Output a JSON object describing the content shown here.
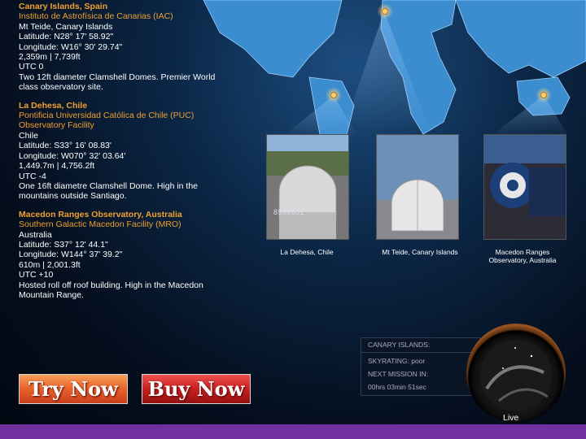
{
  "sites": [
    {
      "title": "Canary Islands, Spain",
      "institute": "Instituto de Astrofísica de Canarias (IAC)",
      "location": "Mt Teide, Canary Islands",
      "latitude": "Latitude: N28° 17' 58.92\"",
      "longitude": "Longitude: W16° 30' 29.74\"",
      "elevation": "2,359m | 7,739ft",
      "utc": "UTC 0",
      "desc1": "Two 12ft diameter Clamshell Domes. Premier World",
      "desc2": "class observatory site."
    },
    {
      "title": "La Dehesa, Chile",
      "institute": "Pontificia Universidad Católica de Chile (PUC)",
      "institute2": "Observatory Facility",
      "location": "Chile",
      "latitude": "Latitude: S33° 16' 08.83'",
      "longitude": "Longitude: W070° 32' 03.64'",
      "elevation": "1,449.7m | 4,756.2ft",
      "utc": "UTC -4",
      "desc1": "One 16ft diametre Clamshell Dome. High in the",
      "desc2": "mountains outside Santiago."
    },
    {
      "title": "Macedon Ranges Observatory, Australia",
      "institute": "Southern Galactic Macedon Facility (MRO)",
      "location": "Australia",
      "latitude": "Latitude: S37° 12' 44.1\"",
      "longitude": "Longitude: W144° 37' 39.2\"",
      "elevation": "610m | 2,001.3ft",
      "utc": "UTC +10",
      "desc1": "Hosted roll off roof building. High in the Macedon",
      "desc2": "Mountain Range."
    }
  ],
  "photos": {
    "size_label": "896x651",
    "captions": [
      "La Dehesa, Chile",
      "Mt Teide, Canary Islands",
      "Macedon Ranges",
      "Observatory, Australia"
    ]
  },
  "buttons": {
    "try": "Try Now",
    "buy": "Buy Now"
  },
  "status": {
    "site": "CANARY ISLANDS:",
    "skyrating": "SKYRATING: poor",
    "next_mission": "NEXT MISSION IN:",
    "countdown": "00hrs 03min 51sec"
  },
  "live_label": "Live",
  "colors": {
    "accent": "#f0a030",
    "bottom_bar": "#7030a0",
    "ocean": "#0b2848",
    "land": "#3c8dd0"
  }
}
